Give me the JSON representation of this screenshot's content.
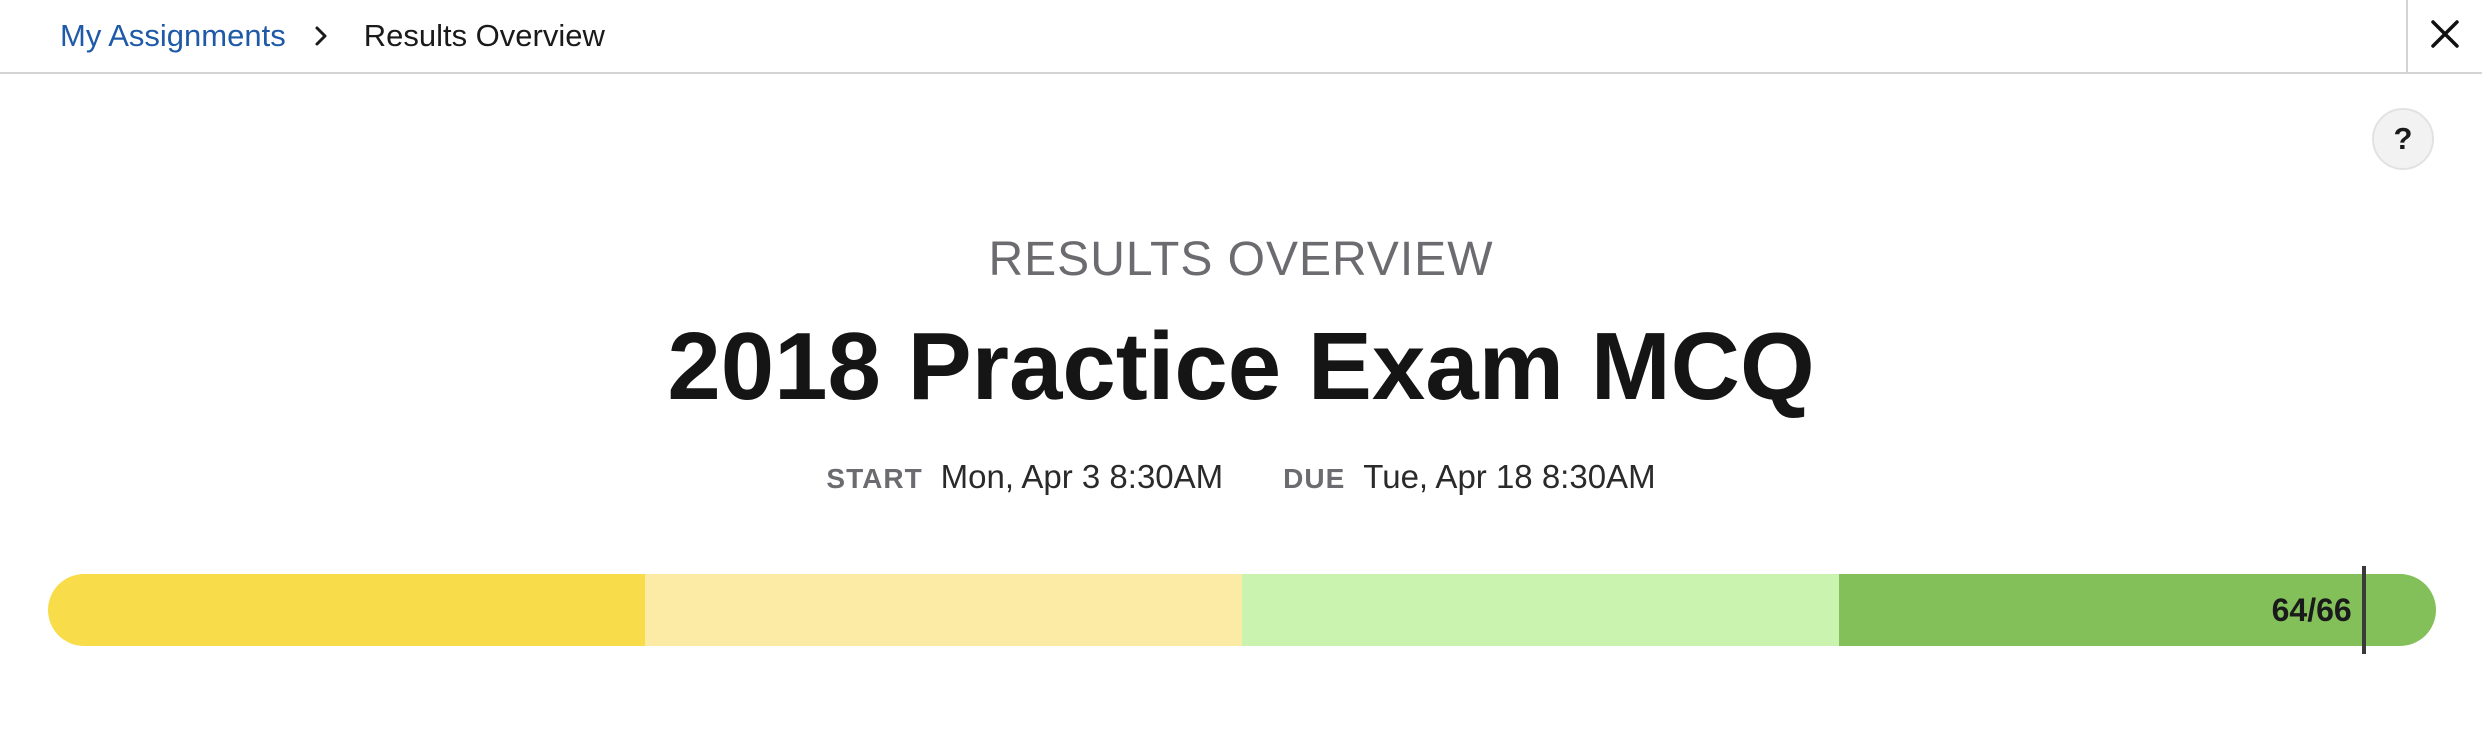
{
  "breadcrumb": {
    "parent": "My Assignments",
    "current": "Results Overview"
  },
  "header": {
    "close_icon": "close-icon",
    "help_label": "?"
  },
  "overview": {
    "subtitle": "RESULTS OVERVIEW",
    "title": "2018 Practice Exam MCQ",
    "start_label": "START",
    "start_value": "Mon, Apr 3 8:30AM",
    "due_label": "DUE",
    "due_value": "Tue, Apr 18 8:30AM"
  },
  "score_bar": {
    "score_text": "64/66",
    "score": 64,
    "total": 66,
    "segment_colors": [
      "#f8dc4a",
      "#fbeba4",
      "#caf3b0",
      "#83c05a"
    ]
  },
  "colors": {
    "link": "#1f5aa8",
    "muted": "#6b6b70",
    "title": "#151515"
  }
}
